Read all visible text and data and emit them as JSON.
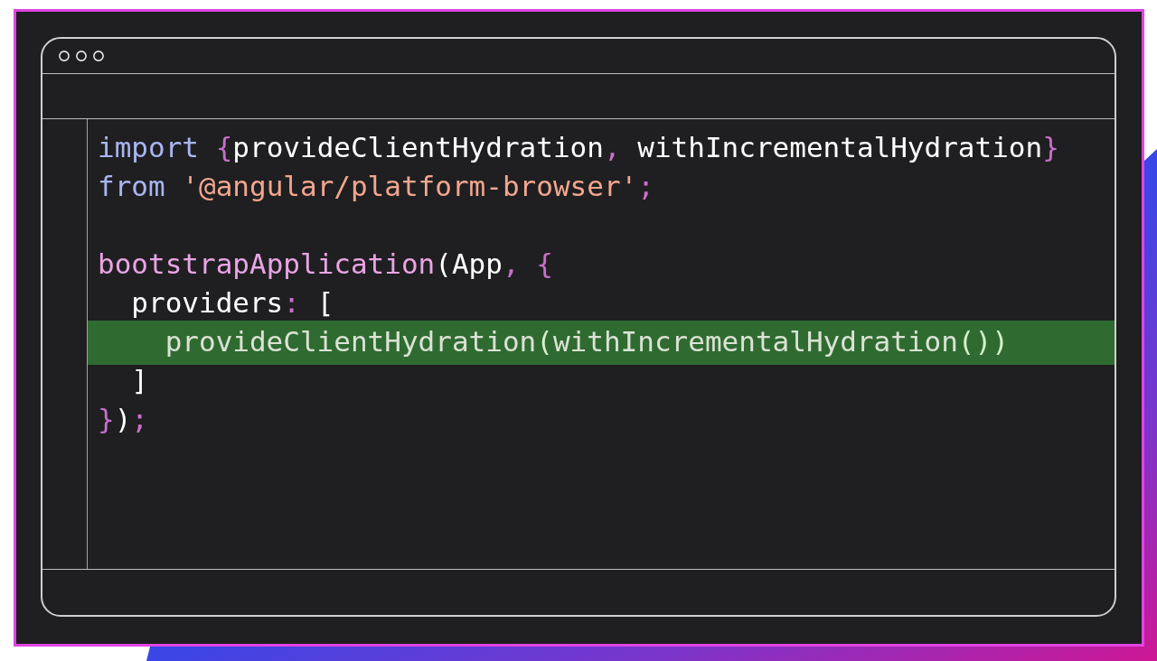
{
  "code_window": {
    "lines": [
      {
        "highlighted": false,
        "tokens": [
          {
            "kind": "keyword",
            "text": "import"
          },
          {
            "kind": "punctuation",
            "text": " {"
          },
          {
            "kind": "text",
            "text": "provideClientHydration"
          },
          {
            "kind": "punctuation",
            "text": ","
          },
          {
            "kind": "text",
            "text": " withIncrementalHydration"
          },
          {
            "kind": "punctuation",
            "text": "}"
          }
        ]
      },
      {
        "highlighted": false,
        "tokens": [
          {
            "kind": "keyword",
            "text": "from"
          },
          {
            "kind": "string",
            "text": " '@angular/platform-browser'"
          },
          {
            "kind": "punctuation",
            "text": ";"
          }
        ]
      },
      {
        "highlighted": false
      },
      {
        "highlighted": false,
        "tokens": [
          {
            "kind": "function",
            "text": "bootstrapApplication"
          },
          {
            "kind": "text",
            "text": "(App"
          },
          {
            "kind": "punctuation",
            "text": ", {"
          }
        ],
        "children": [
          {
            "highlighted": false,
            "tokens": [
              {
                "kind": "text",
                "text": "providers"
              },
              {
                "kind": "punctuation",
                "text": ":"
              },
              {
                "kind": "text",
                "text": " ["
              }
            ],
            "children": [
              {
                "highlighted": true,
                "tokens": [
                  {
                    "kind": "function",
                    "text": "provideClientHydration"
                  },
                  {
                    "kind": "text",
                    "text": "("
                  },
                  {
                    "kind": "function",
                    "text": "withIncrementalHydration"
                  },
                  {
                    "kind": "text",
                    "text": "())"
                  }
                ]
              }
            ]
          },
          {
            "highlighted": false,
            "tokens": [
              {
                "kind": "text",
                "text": "]"
              }
            ]
          }
        ]
      },
      {
        "highlighted": false,
        "tokens": [
          {
            "kind": "punctuation",
            "text": "}"
          },
          {
            "kind": "text",
            "text": ")"
          },
          {
            "kind": "punctuation",
            "text": ";"
          }
        ]
      }
    ]
  }
}
